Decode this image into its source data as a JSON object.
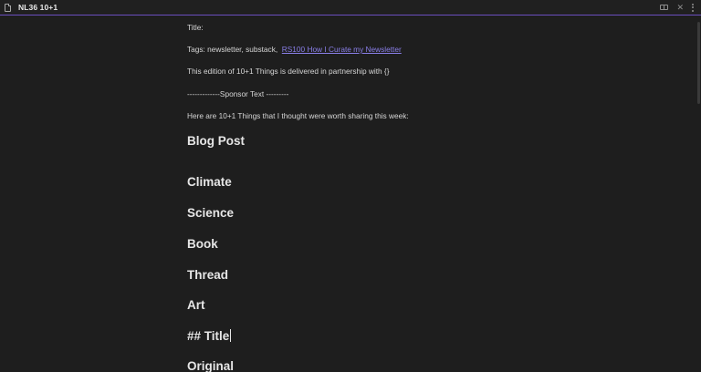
{
  "tab": {
    "title": "NL36 10+1"
  },
  "title_actions": {
    "reading_icon": "book-open-icon",
    "close_glyph": "✕",
    "more_icon": "more-vertical-icon"
  },
  "colors": {
    "accent": "#6b4fbf",
    "background": "#1e1e1e",
    "link": "#8a7fe8"
  },
  "document": {
    "title_line": "Title:",
    "tags_prefix": "Tags: newsletter, substack,",
    "tags_link": "RS100 How I Curate my Newsletter",
    "partnership_line": "This edition of 10+1 Things is delivered in partnership with {}",
    "sponsor_line": "-------------Sponsor Text ---------",
    "intro_line": "Here are 10+1 Things that I thought were worth sharing this week:",
    "headings": {
      "blog_post": "Blog Post",
      "climate": "Climate",
      "science": "Science",
      "book": "Book",
      "thread": "Thread",
      "art": "Art",
      "markdown_title": "## Title",
      "original": "Original"
    }
  }
}
